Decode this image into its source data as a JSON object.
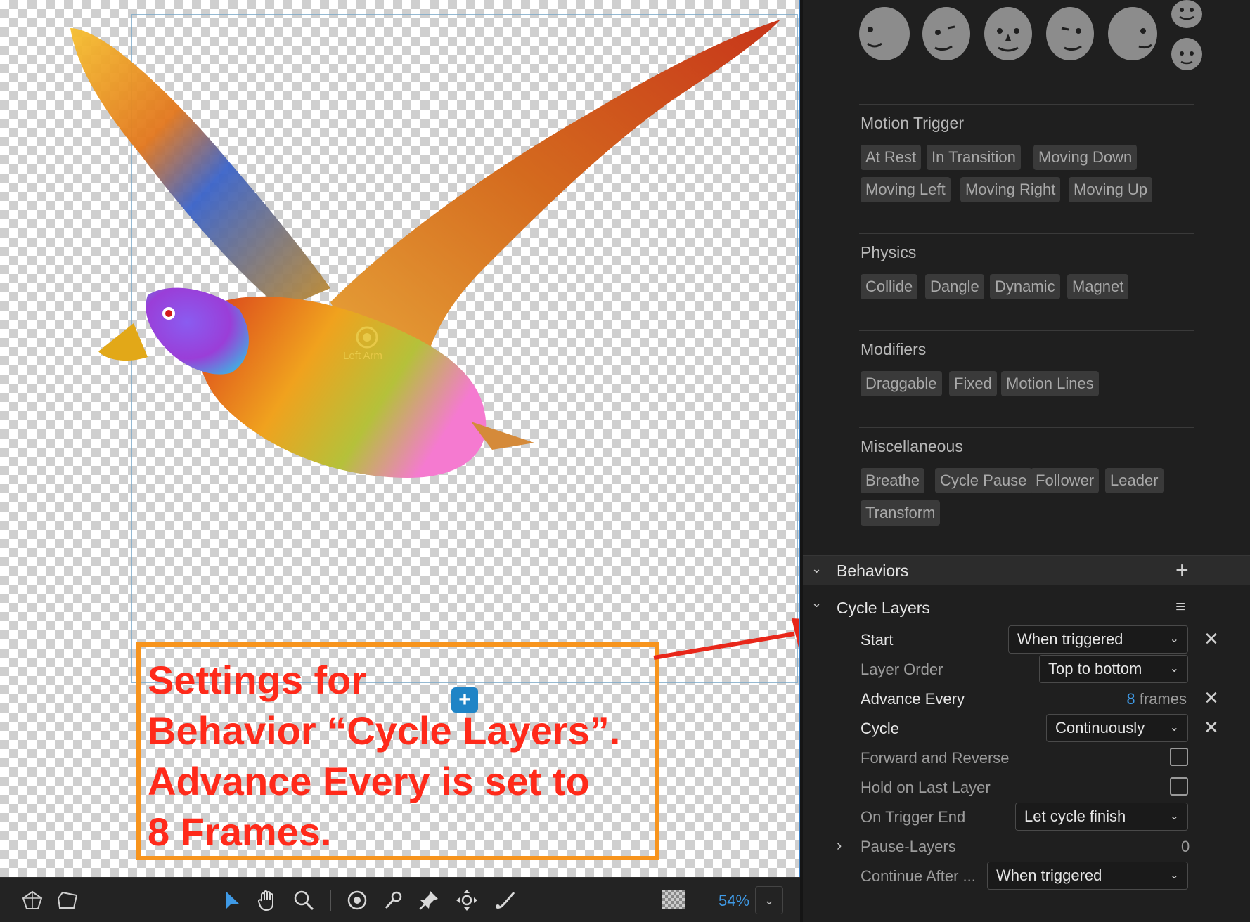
{
  "canvas": {
    "handle_label": "Left Arm",
    "annotation": {
      "lines": [
        "Settings for",
        "Behavior “Cycle Layers”.",
        "Advance Every is set to",
        "8 Frames."
      ]
    },
    "add_handle_symbol": "+"
  },
  "toolbar": {
    "tools": [
      "handle-icon",
      "shape-icon",
      "select-icon",
      "hand-icon",
      "zoom-icon",
      "origin-icon",
      "dragger-icon",
      "pin-icon",
      "transform-icon",
      "stick-icon"
    ],
    "zoom": "54%",
    "zoom_chevron": "⌄"
  },
  "panel": {
    "faces": [
      "face-left-icon",
      "face-wink-icon",
      "face-front-icon",
      "face-right-icon",
      "face-profile-icon",
      "face-up-icon",
      "face-down-icon"
    ],
    "sections": [
      {
        "title": "Motion Trigger",
        "tags": [
          "At Rest",
          "In Transition",
          "Moving Down",
          "Moving Left",
          "Moving Right",
          "Moving Up"
        ]
      },
      {
        "title": "Physics",
        "tags": [
          "Collide",
          "Dangle",
          "Dynamic",
          "Magnet"
        ]
      },
      {
        "title": "Modifiers",
        "tags": [
          "Draggable",
          "Fixed",
          "Motion Lines"
        ]
      },
      {
        "title": "Miscellaneous",
        "tags": [
          "Breathe",
          "Cycle Pause",
          "Follower",
          "Leader",
          "Transform"
        ]
      }
    ],
    "behaviors": {
      "title": "Behaviors",
      "add_symbol": "+",
      "cycle_layers": {
        "title": "Cycle Layers",
        "menu_symbol": "≡",
        "start": {
          "label": "Start",
          "value": "When triggered"
        },
        "layer_order": {
          "label": "Layer Order",
          "value": "Top to bottom"
        },
        "advance_every": {
          "label": "Advance Every",
          "number": "8",
          "unit": "frames"
        },
        "cycle": {
          "label": "Cycle",
          "value": "Continuously"
        },
        "forward_reverse": {
          "label": "Forward and Reverse",
          "checked": false
        },
        "hold_last": {
          "label": "Hold on Last Layer",
          "checked": false
        },
        "on_trigger_end": {
          "label": "On Trigger End",
          "value": "Let cycle finish"
        },
        "pause_layers": {
          "label": "Pause-Layers",
          "value": "0"
        },
        "continue_after": {
          "label": "Continue After ...",
          "value": "When triggered"
        }
      }
    }
  },
  "colors": {
    "annotation_text": "#ff2a1a",
    "annotation_border": "#f7941d",
    "accent_blue": "#3f9ae6"
  }
}
